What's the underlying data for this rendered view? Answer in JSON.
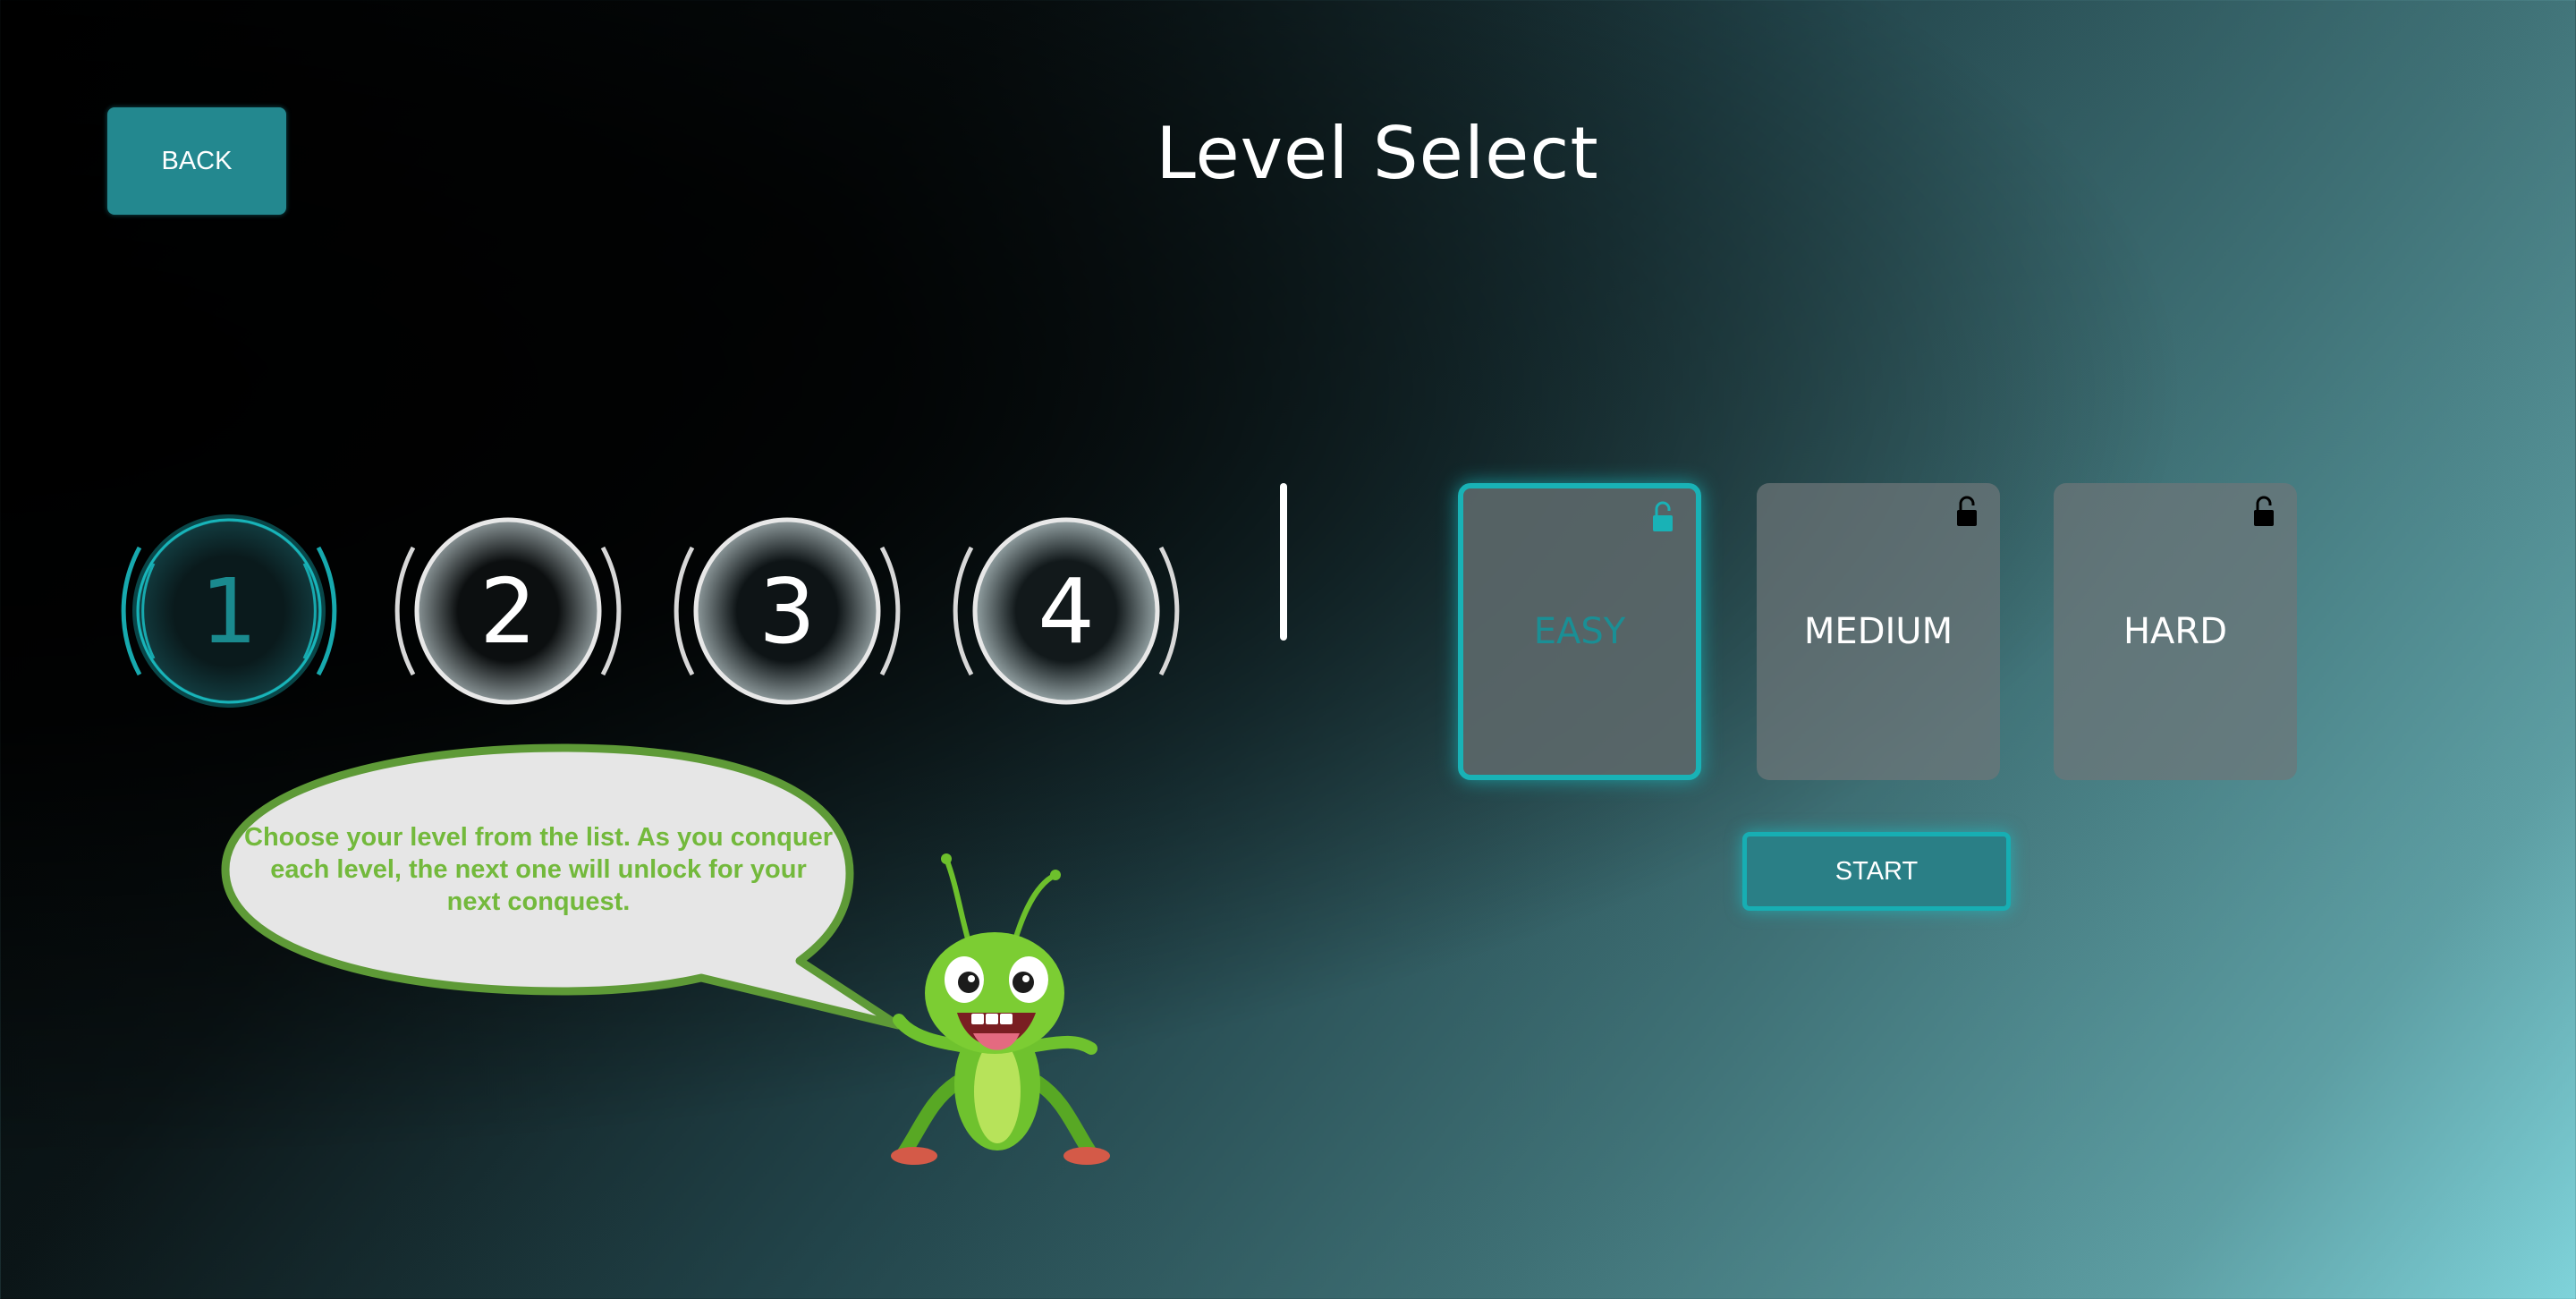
{
  "header": {
    "title": "Level Select",
    "back_label": "BACK"
  },
  "levels": [
    {
      "number": "1",
      "state": "selected"
    },
    {
      "number": "2",
      "state": "available"
    },
    {
      "number": "3",
      "state": "available"
    },
    {
      "number": "4",
      "state": "available"
    }
  ],
  "difficulty": {
    "options": [
      {
        "label": "EASY",
        "selected": true,
        "lock_icon": "unlocked-icon"
      },
      {
        "label": "MEDIUM",
        "selected": false,
        "lock_icon": "unlocked-icon"
      },
      {
        "label": "HARD",
        "selected": false,
        "lock_icon": "unlocked-icon"
      }
    ],
    "start_label": "START"
  },
  "mascot": {
    "message": "Choose your level from the list. As you conquer each level, the next one will unlock for your next conquest.",
    "icon": "grasshopper-mascot"
  },
  "colors": {
    "accent": "#19b2b6",
    "button": "#23888f",
    "bubble_border": "#5e9a37",
    "bubble_text": "#73b93c",
    "bubble_fill": "#e6e6e6"
  }
}
